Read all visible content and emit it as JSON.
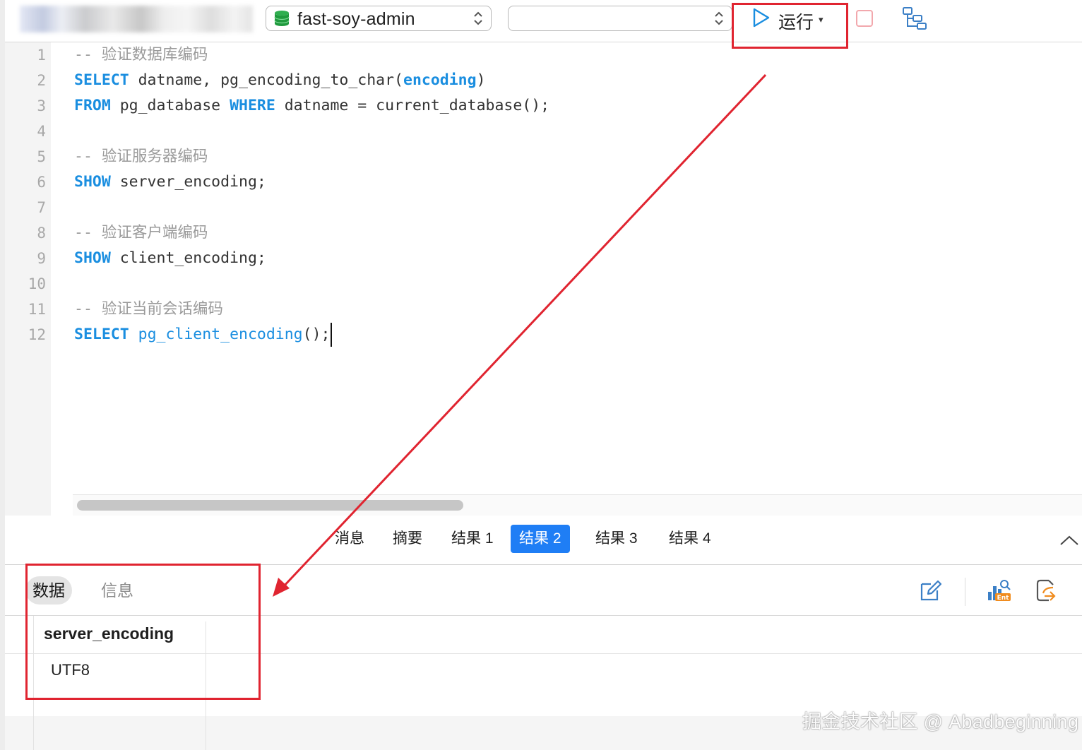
{
  "toolbar": {
    "database_select": {
      "value": "fast-soy-admin"
    },
    "schema_select": {
      "value": ""
    },
    "run_label": "运行",
    "run_caret": "▾"
  },
  "editor": {
    "line_numbers": [
      "1",
      "2",
      "3",
      "4",
      "5",
      "6",
      "7",
      "8",
      "9",
      "10",
      "11",
      "12"
    ],
    "lines": [
      [
        {
          "t": "-- 验证数据库编码",
          "c": "cm"
        }
      ],
      [
        {
          "t": "SELECT",
          "c": "kw"
        },
        {
          "t": " datname, pg_encoding_to_char(",
          "c": ""
        },
        {
          "t": "encoding",
          "c": "kw"
        },
        {
          "t": ")",
          "c": ""
        }
      ],
      [
        {
          "t": "FROM",
          "c": "kw"
        },
        {
          "t": " pg_database ",
          "c": ""
        },
        {
          "t": "WHERE",
          "c": "kw"
        },
        {
          "t": " datname = current_database();",
          "c": ""
        }
      ],
      [],
      [
        {
          "t": "-- 验证服务器编码",
          "c": "cm"
        }
      ],
      [
        {
          "t": "SHOW",
          "c": "kw"
        },
        {
          "t": " server_encoding;",
          "c": ""
        }
      ],
      [],
      [
        {
          "t": "-- 验证客户端编码",
          "c": "cm"
        }
      ],
      [
        {
          "t": "SHOW",
          "c": "kw"
        },
        {
          "t": " client_encoding;",
          "c": ""
        }
      ],
      [],
      [
        {
          "t": "-- 验证当前会话编码",
          "c": "cm"
        }
      ],
      [
        {
          "t": "SELECT",
          "c": "kw"
        },
        {
          "t": " ",
          "c": ""
        },
        {
          "t": "pg_client_encoding",
          "c": "fn"
        },
        {
          "t": "();",
          "c": ""
        }
      ]
    ]
  },
  "results": {
    "tabs": [
      "消息",
      "摘要",
      "结果 1",
      "结果 2",
      "结果 3",
      "结果 4"
    ],
    "active_tab": "结果 2"
  },
  "subtabs": {
    "data": "数据",
    "info": "信息"
  },
  "actions": [
    "edit-icon",
    "chart-data-icon",
    "export-icon"
  ],
  "grid": {
    "columns": [
      "server_encoding"
    ],
    "rows": [
      [
        "UTF8"
      ]
    ]
  },
  "watermark": "掘金技术社区 @ Abadbeginning",
  "colors": {
    "keyword": "#1a8ee0",
    "comment": "#9a9a9a",
    "active_tab": "#1f7ef5",
    "annotation": "#e02430"
  }
}
